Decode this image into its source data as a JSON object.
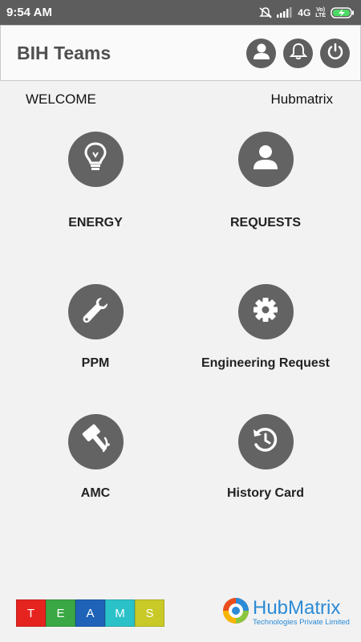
{
  "status_bar": {
    "time": "9:54 AM",
    "network": "4G",
    "volte_top": "Vo)",
    "volte_bottom": "LTE",
    "icons": [
      "mute-icon",
      "signal-icon",
      "battery-charging-icon"
    ]
  },
  "appbar": {
    "title": "BIH Teams",
    "actions": [
      "profile-icon",
      "bell-icon",
      "power-icon"
    ]
  },
  "welcome": {
    "label": "WELCOME",
    "user": "Hubmatrix"
  },
  "tiles": [
    {
      "label": "ENERGY",
      "icon": "lightbulb-icon"
    },
    {
      "label": "REQUESTS",
      "icon": "person-icon"
    },
    {
      "label": "PPM",
      "icon": "wrench-icon"
    },
    {
      "label": "Engineering Request",
      "icon": "gear-icon"
    },
    {
      "label": "AMC",
      "icon": "gavel-icon"
    },
    {
      "label": "History Card",
      "icon": "history-icon"
    }
  ],
  "footer": {
    "teams_letters": [
      "T",
      "E",
      "A",
      "M",
      "S"
    ],
    "teams_colors": [
      "#e52420",
      "#3aa844",
      "#1e63b8",
      "#2ac2c8",
      "#c9c928"
    ],
    "brand_name": "HubMatrix",
    "brand_tagline": "Technologies Private Limited"
  },
  "colors": {
    "status_bar": "#5d5d5d",
    "icon_circle": "#636363",
    "brand_blue": "#2b8bd6"
  }
}
